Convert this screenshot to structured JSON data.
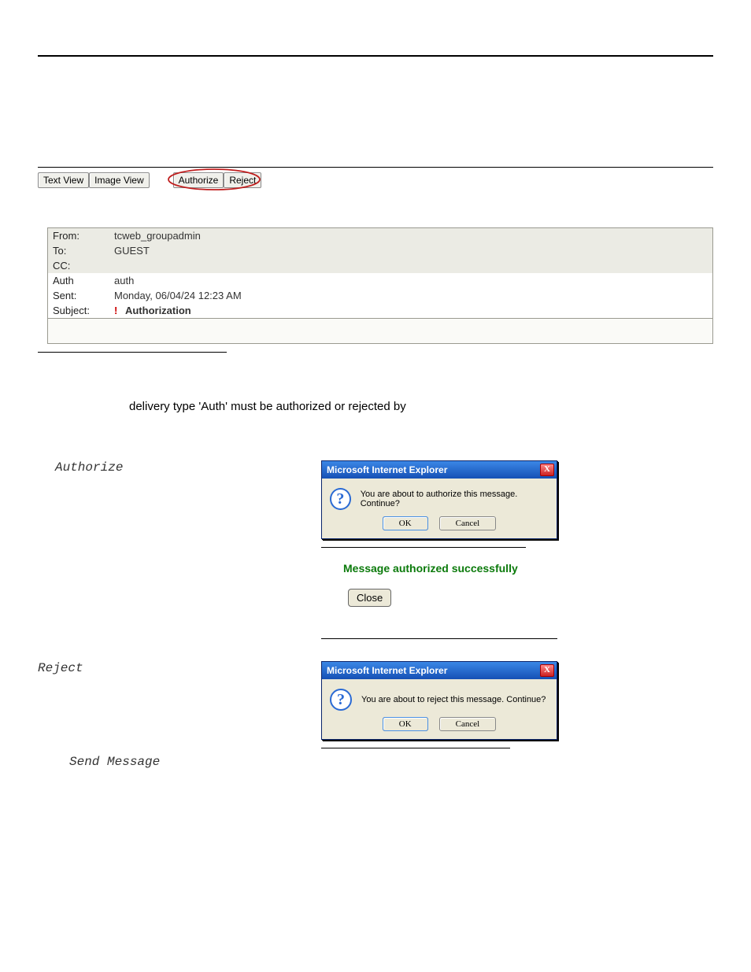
{
  "toolbar": {
    "text_view": "Text View",
    "image_view": "Image View",
    "authorize": "Authorize",
    "reject": "Reject"
  },
  "message": {
    "from_label": "From:",
    "from_value": "tcweb_groupadmin",
    "to_label": "To:",
    "to_value": "GUEST",
    "cc_label": "CC:",
    "cc_value": "",
    "auth_label": "Auth",
    "auth_value": "auth",
    "sent_label": "Sent:",
    "sent_value": "Monday, 06/04/24 12:23 AM",
    "subject_label": "Subject:",
    "subject_icon": "!",
    "subject_value": "Authorization"
  },
  "desc": "delivery type 'Auth' must be authorized or rejected by",
  "labels": {
    "authorize": "Authorize",
    "reject": "Reject",
    "send_message": "Send Message"
  },
  "dialog_auth": {
    "title": "Microsoft Internet Explorer",
    "message": "You are about to authorize this message. Continue?",
    "ok": "OK",
    "cancel": "Cancel",
    "close_x": "X"
  },
  "success": {
    "text": "Message authorized successfully",
    "close": "Close"
  },
  "dialog_reject": {
    "title": "Microsoft Internet Explorer",
    "message": "You are about to reject this message. Continue?",
    "ok": "OK",
    "cancel": "Cancel",
    "close_x": "X"
  }
}
